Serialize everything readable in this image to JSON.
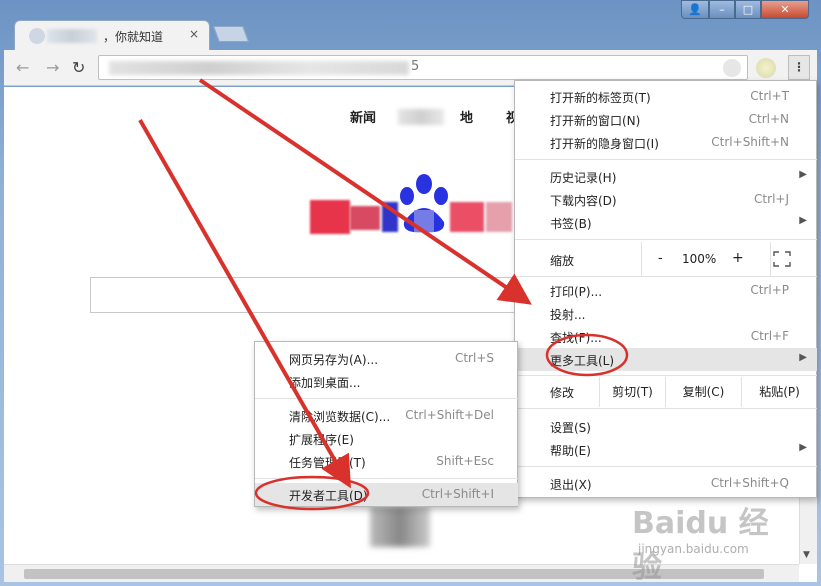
{
  "tab": {
    "title": "，你就知道",
    "close": "×"
  },
  "window_controls": {
    "user": "👤",
    "minimize": "–",
    "maximize": "□",
    "close": "✕"
  },
  "toolbar": {
    "back": "←",
    "forward": "→",
    "reload": "↻",
    "url_suffix": "5",
    "menu": "⋮"
  },
  "page": {
    "nav": [
      "新闻",
      "地",
      "视"
    ]
  },
  "main_menu": {
    "items": [
      {
        "label": "打开新的标签页(T)",
        "shortcut": "Ctrl+T"
      },
      {
        "label": "打开新的窗口(N)",
        "shortcut": "Ctrl+N"
      },
      {
        "label": "打开新的隐身窗口(I)",
        "shortcut": "Ctrl+Shift+N"
      },
      {
        "label": "历史记录(H)",
        "shortcut": ""
      },
      {
        "label": "下载内容(D)",
        "shortcut": "Ctrl+J"
      },
      {
        "label": "书签(B)",
        "shortcut": ""
      },
      {
        "label": "打印(P)...",
        "shortcut": "Ctrl+P"
      },
      {
        "label": "投射...",
        "shortcut": ""
      },
      {
        "label": "查找(F)...",
        "shortcut": "Ctrl+F"
      },
      {
        "label": "更多工具(L)",
        "shortcut": ""
      },
      {
        "label": "设置(S)",
        "shortcut": ""
      },
      {
        "label": "帮助(E)",
        "shortcut": ""
      },
      {
        "label": "退出(X)",
        "shortcut": "Ctrl+Shift+Q"
      }
    ],
    "zoom": {
      "label": "缩放",
      "minus": "-",
      "value": "100%",
      "plus": "+"
    },
    "edit": {
      "label": "修改",
      "cut": "剪切(T)",
      "copy": "复制(C)",
      "paste": "粘贴(P)"
    }
  },
  "sub_menu": {
    "items": [
      {
        "label": "网页另存为(A)...",
        "shortcut": "Ctrl+S"
      },
      {
        "label": "添加到桌面...",
        "shortcut": ""
      },
      {
        "label": "清除浏览数据(C)...",
        "shortcut": "Ctrl+Shift+Del"
      },
      {
        "label": "扩展程序(E)",
        "shortcut": ""
      },
      {
        "label": "任务管理器(T)",
        "shortcut": "Shift+Esc"
      },
      {
        "label": "开发者工具(D)",
        "shortcut": "Ctrl+Shift+I"
      }
    ]
  },
  "watermark": {
    "text": "Baidu 经验",
    "sub": "jingyan.baidu.com"
  },
  "colors": {
    "annotation": "#d9312b",
    "highlight": "#e5e5e5",
    "logo_blue": "#2932e1",
    "logo_red": "#e10602"
  }
}
